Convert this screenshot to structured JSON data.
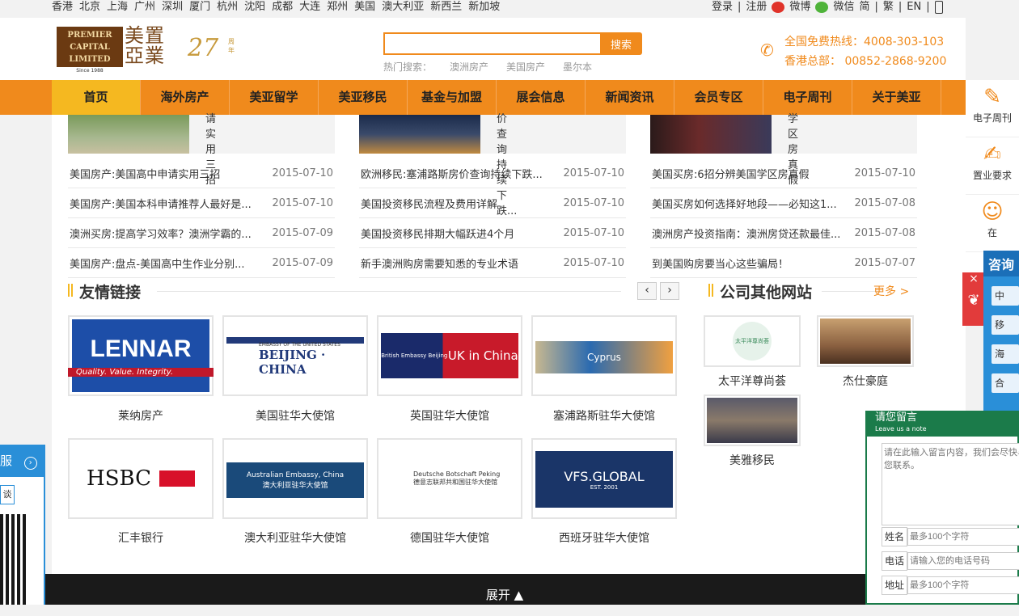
{
  "cities": [
    "香港",
    "北京",
    "上海",
    "广州",
    "深圳",
    "厦门",
    "杭州",
    "沈阳",
    "成都",
    "大连",
    "郑州",
    "美国",
    "澳大利亚",
    "新西兰",
    "新加坡"
  ],
  "toplinks": {
    "login": "登录",
    "sep1": "|",
    "register": "注册",
    "weibo": "微博",
    "weixin": "微信",
    "simp": "简",
    "sep2": "|",
    "trad": "繁",
    "sep3": "|",
    "en": "EN",
    "sep4": "|"
  },
  "logo": {
    "en": "PREMIER CAPITAL LIMITED",
    "since": "Since 1988",
    "cn": "美置亞業",
    "anniv": "27",
    "anniv_label": "周年"
  },
  "search": {
    "placeholder": "",
    "button": "搜索",
    "hot_label": "热门搜索：",
    "hot": [
      "澳洲房产",
      "美国房产",
      "墨尔本"
    ]
  },
  "hotline": {
    "line1": "全国免费热线：4008-303-103",
    "line2": "香港总部： 00852-2868-9200"
  },
  "nav": [
    "首页",
    "海外房产",
    "美亚留学",
    "美亚移民",
    "基金与加盟",
    "展会信息",
    "新闻资讯",
    "会员专区",
    "电子周刊",
    "关于美亚"
  ],
  "sidebar": [
    "电子周刊",
    "置业要求",
    "在"
  ],
  "thumbs": [
    "请实用三招",
    "价查询持续下跌...",
    "学区房真假"
  ],
  "news": [
    [
      {
        "title": "美国房产:美国高中申请实用三招",
        "date": "2015-07-10"
      },
      {
        "title": "美国房产:美国本科申请推荐人最好是...",
        "date": "2015-07-10"
      },
      {
        "title": "澳洲买房:提高学习效率？澳洲学霸的...",
        "date": "2015-07-09"
      },
      {
        "title": "美国房产:盘点-美国高中生作业分别...",
        "date": "2015-07-09"
      }
    ],
    [
      {
        "title": "欧洲移民:塞浦路斯房价查询持续下跌...",
        "date": "2015-07-10"
      },
      {
        "title": "美国投资移民流程及费用详解",
        "date": "2015-07-10"
      },
      {
        "title": "美国投资移民排期大幅跃进4个月",
        "date": "2015-07-10"
      },
      {
        "title": "新手澳洲购房需要知悉的专业术语",
        "date": "2015-07-10"
      }
    ],
    [
      {
        "title": "美国买房:6招分辨美国学区房真假",
        "date": "2015-07-10"
      },
      {
        "title": "美国买房如何选择好地段——必知这1...",
        "date": "2015-07-08"
      },
      {
        "title": "澳洲房产投资指南：澳洲房贷还款最佳...",
        "date": "2015-07-08"
      },
      {
        "title": "到美国购房要当心这些骗局！",
        "date": "2015-07-07"
      }
    ]
  ],
  "friends": {
    "title": "友情链接",
    "prev": "‹",
    "next": "›",
    "items": [
      {
        "name": "莱纳房产",
        "logo": "LENNAR",
        "sub": "Quality. Value. Integrity."
      },
      {
        "name": "美国驻华大使馆",
        "logo": "BEIJING · CHINA",
        "sub": "EMBASSY OF THE UNITED STATES"
      },
      {
        "name": "英国驻华大使馆",
        "logo": "UK in China",
        "sub": "British Embassy Beijing"
      },
      {
        "name": "塞浦路斯驻华大使馆",
        "logo": "Cyprus",
        "sub": "Cyprus"
      },
      {
        "name": "汇丰银行",
        "logo": "HSBC",
        "sub": ""
      },
      {
        "name": "澳大利亚驻华大使馆",
        "logo": "Australian Embassy, China",
        "sub": "澳大利亚驻华大使馆"
      },
      {
        "name": "德国驻华大使馆",
        "logo": "Deutsche Botschaft Peking",
        "sub": "德意志联邦共和国驻华大使馆"
      },
      {
        "name": "西班牙驻华大使馆",
        "logo": "VFS.GLOBAL",
        "sub": "EST. 2001"
      }
    ]
  },
  "sites": {
    "title": "公司其他网站",
    "more": "更多 >",
    "items": [
      {
        "name": "太平洋尊尚荟",
        "logo": "太平洋尊尚荟"
      },
      {
        "name": "杰仕豪庭"
      },
      {
        "name": "美雅移民"
      }
    ]
  },
  "expand": "展开 ▲",
  "left_float": {
    "title": "服",
    "btn": "谈"
  },
  "consult": {
    "title": "咨询",
    "rows": [
      "中",
      "移",
      "海",
      "合"
    ]
  },
  "message": {
    "title": "请您留言",
    "subtitle": "Leave us a note",
    "placeholder": "请在此输入留言内容，我们会尽快与您联系。",
    "fields": [
      {
        "label": "姓名",
        "placeholder": "最多100个字符"
      },
      {
        "label": "电话",
        "placeholder": "请输入您的电话号码"
      },
      {
        "label": "地址",
        "placeholder": "最多100个字符"
      }
    ]
  },
  "colors": {
    "accent": "#f08a1c",
    "nav_active": "#f5b820",
    "consult": "#2a8fd8",
    "message": "#1b7b4a"
  }
}
